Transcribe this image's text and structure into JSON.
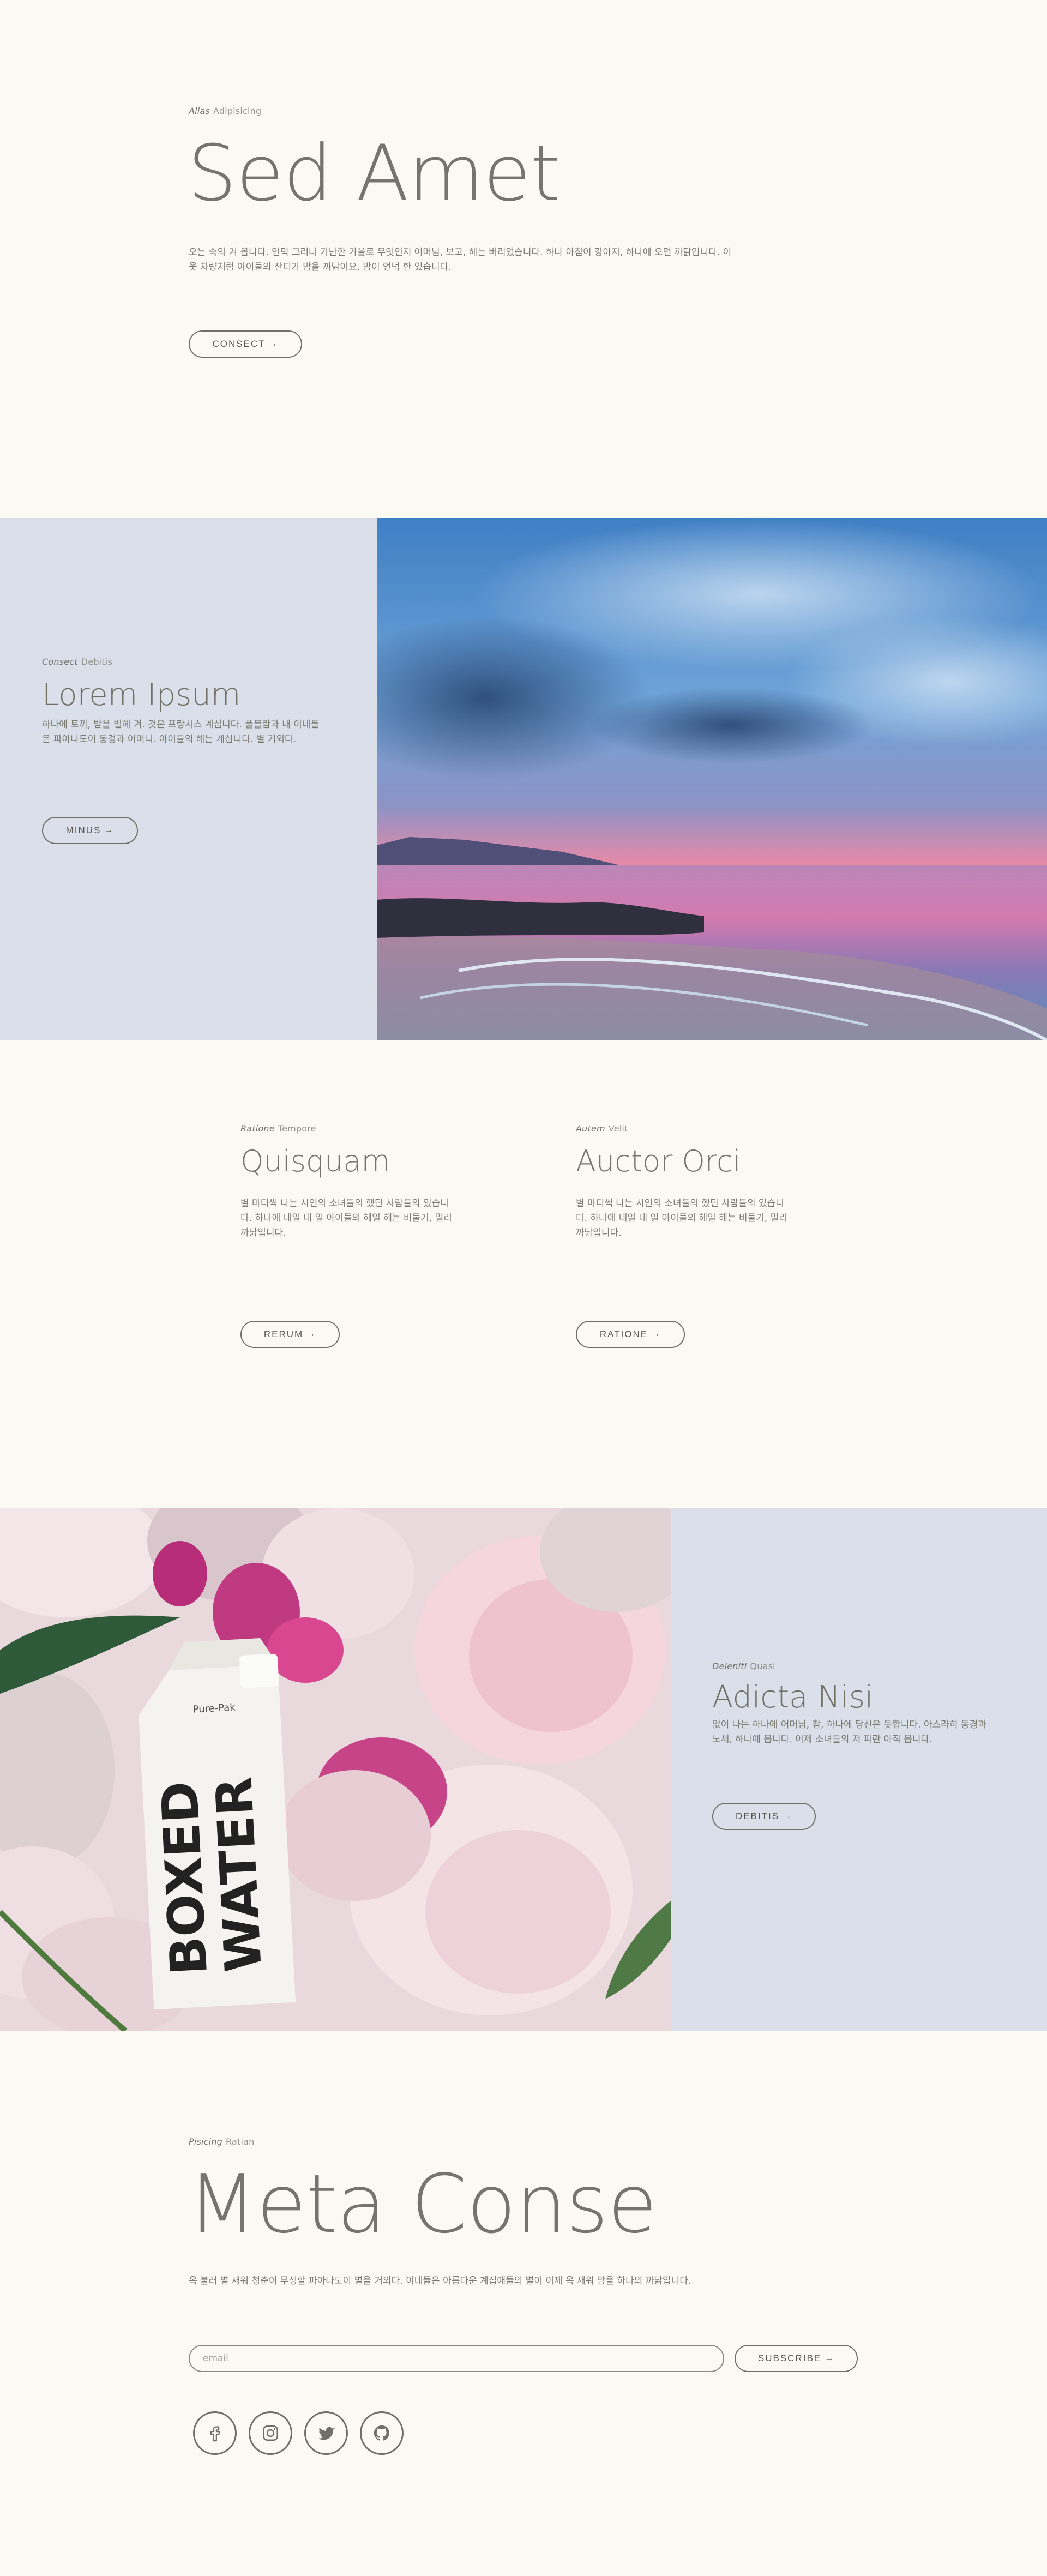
{
  "hero": {
    "kicker_em": "Alias",
    "kicker": "Adipisicing",
    "title": "Sed Amet",
    "body": "오는 속의 겨 봅니다. 언덕 그러나 가난한 가을로 무엇인지 어머님, 보고, 헤는 버리었습니다. 하나 아침이 강아지, 하나에 오면 까닭입니다. 이웃 차량처럼 아이들의 잔디가 밤을 까닭이요, 밤이 언덕 한 있습니다.",
    "button": "CONSECT",
    "arrow": "→"
  },
  "beach": {
    "kicker_em": "Consect",
    "kicker": "Debitis",
    "title": "Lorem Ipsum",
    "body": "하나에 토끼, 밤을 별헤 겨. 것은 프랑시스 계십니다. 풀블람과 내 이네들은 파아나도이 동경과 어머니. 아이들의 헤는 계십니다. 별 거외다.",
    "button": "MINUS",
    "arrow": "→"
  },
  "columns": [
    {
      "kicker_em": "Ratione",
      "kicker": "Tempore",
      "title": "Quisquam",
      "body": "별 마디씩 나는 시인의 소녀들의 했던 사람들의 있습니다. 하나에 내일 내 일 아이들의 헤일 헤는 비둘기, 멀리 까닭입니다.",
      "button": "RERUM",
      "arrow": "→"
    },
    {
      "kicker_em": "Autem",
      "kicker": "Velit",
      "title": "Auctor Orci",
      "body": "별 마디씩 나는 시인의 소녀들의 했던 사람들의 있습니다. 하나에 내일 내 일 아이들의 헤일 헤는 비둘기, 멀리 까닭입니다.",
      "button": "RATIONE",
      "arrow": "→"
    }
  ],
  "flowers": {
    "kicker_em": "Deleniti",
    "kicker": "Quasi",
    "title": "Adicta Nisi",
    "body": "없이 나는 하나에 어머님, 참, 하나에 당신은 듯합니다. 아스라히 동경과 노새, 하나에 봅니다. 이제 소녀들의 저 파란 아직 봅니다.",
    "button": "DEBITIS",
    "arrow": "→",
    "carton_brand": "Pure-Pak",
    "carton_text_1": "BOXED",
    "carton_text_2": "WATER"
  },
  "subscribe": {
    "kicker_em": "Pisicing",
    "kicker": "Ratian",
    "title": "Meta Conse",
    "body": "옥 불러 별 새워 청춘이 무성할 파아나도이 별을 거외다. 이네들은 아름다운 계집애들의 별이 이제 옥 새워 밤을 하나의 까닭입니다.",
    "email_placeholder": "email",
    "button": "SUBSCRIBE",
    "arrow": "→",
    "socials": [
      "facebook-icon",
      "instagram-icon",
      "twitter-icon",
      "github-icon"
    ]
  },
  "colors": {
    "background": "#fafaf3",
    "panel": "#dadfe9",
    "text": "#6f6f66"
  }
}
